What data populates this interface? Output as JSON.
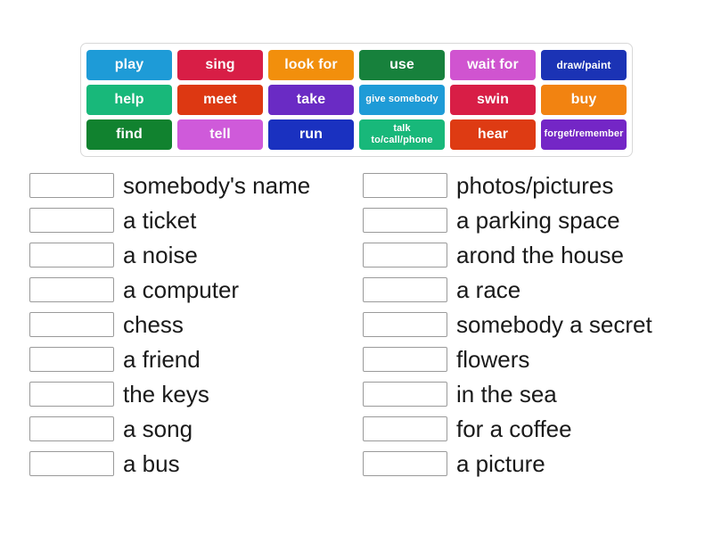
{
  "wordbank": {
    "rows": [
      [
        {
          "label": "play",
          "color": "#1e9bd7",
          "size": "normal"
        },
        {
          "label": "sing",
          "color": "#d81e46",
          "size": "normal"
        },
        {
          "label": "look for",
          "color": "#f28f0c",
          "size": "normal"
        },
        {
          "label": "use",
          "color": "#17813c",
          "size": "normal"
        },
        {
          "label": "wait for",
          "color": "#d054d0",
          "size": "normal"
        },
        {
          "label": "draw/paint",
          "color": "#1b33b5",
          "size": "small"
        }
      ],
      [
        {
          "label": "help",
          "color": "#18b87a",
          "size": "normal"
        },
        {
          "label": "meet",
          "color": "#dd3812",
          "size": "normal"
        },
        {
          "label": "take",
          "color": "#6a2bc4",
          "size": "normal"
        },
        {
          "label": "give somebody",
          "color": "#1e9bd7",
          "size": "xsmall"
        },
        {
          "label": "swin",
          "color": "#d81e46",
          "size": "normal"
        },
        {
          "label": "buy",
          "color": "#f28311",
          "size": "normal"
        }
      ],
      [
        {
          "label": "find",
          "color": "#11822f",
          "size": "normal"
        },
        {
          "label": "tell",
          "color": "#cf5ada",
          "size": "normal"
        },
        {
          "label": "run",
          "color": "#1a31c0",
          "size": "normal"
        },
        {
          "label": "talk\nto/call/phone",
          "color": "#18b87a",
          "size": "two-line"
        },
        {
          "label": "hear",
          "color": "#de3b13",
          "size": "normal"
        },
        {
          "label": "forget/remember",
          "color": "#7426c6",
          "size": "xsmall"
        }
      ]
    ]
  },
  "answers": {
    "left": [
      {
        "text": "somebody's name"
      },
      {
        "text": "a ticket"
      },
      {
        "text": "a noise"
      },
      {
        "text": "a computer"
      },
      {
        "text": "chess"
      },
      {
        "text": "a friend"
      },
      {
        "text": "the keys"
      },
      {
        "text": "a song"
      },
      {
        "text": "a bus"
      }
    ],
    "right": [
      {
        "text": "photos/pictures"
      },
      {
        "text": "a parking space"
      },
      {
        "text": "arond the house"
      },
      {
        "text": "a race"
      },
      {
        "text": "somebody a secret"
      },
      {
        "text": "flowers"
      },
      {
        "text": "in the sea"
      },
      {
        "text": "for a coffee"
      },
      {
        "text": "a picture"
      }
    ]
  }
}
